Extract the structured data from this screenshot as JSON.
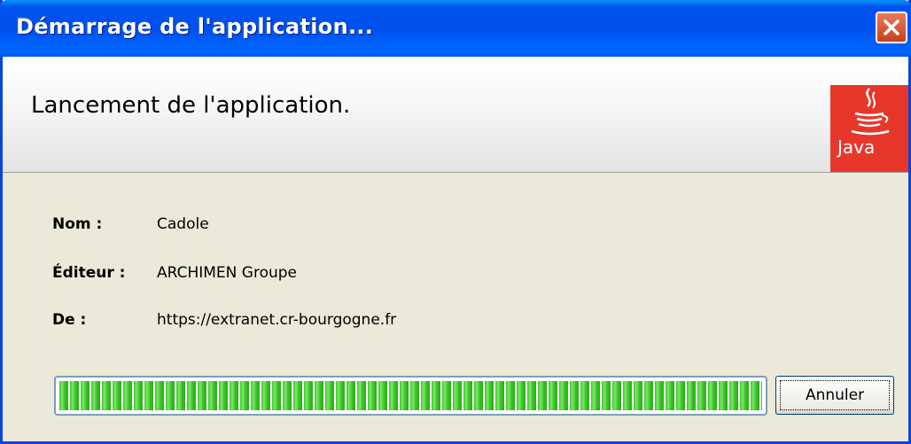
{
  "window": {
    "title": "Démarrage de l'application..."
  },
  "header": {
    "title": "Lancement de l'application.",
    "logo_text": "Java"
  },
  "info": {
    "name_label": "Nom :",
    "name_value": "Cadole",
    "publisher_label": "Éditeur :",
    "publisher_value": "ARCHIMEN Groupe",
    "from_label": "De :",
    "from_value": "https://extranet.cr-bourgogne.fr"
  },
  "progress": {
    "value": 1.0
  },
  "buttons": {
    "cancel_label": "Annuler"
  },
  "colors": {
    "titlebar": "#0053EE",
    "progress_green": "#3EC52B",
    "java_red": "#E7372B"
  }
}
